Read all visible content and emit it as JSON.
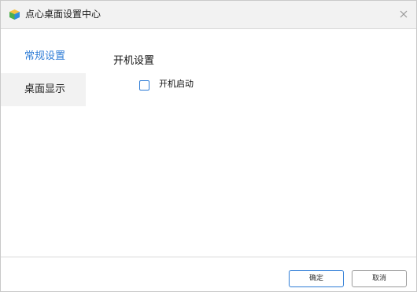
{
  "window": {
    "title": "点心桌面设置中心"
  },
  "sidebar": {
    "items": [
      {
        "label": "常规设置",
        "active": true
      },
      {
        "label": "桌面显示",
        "active": false
      }
    ]
  },
  "main": {
    "section_title": "开机设置",
    "options": [
      {
        "label": "开机启动",
        "checked": false
      }
    ]
  },
  "footer": {
    "ok_label": "确定",
    "cancel_label": "取消"
  },
  "colors": {
    "accent": "#2e7cd6",
    "titlebar_bg": "#f2f2f2",
    "inactive_nav_bg": "#f2f2f2"
  },
  "icons": {
    "app": "cube-app-icon",
    "close": "close-icon",
    "checkbox": "checkbox-unchecked"
  }
}
